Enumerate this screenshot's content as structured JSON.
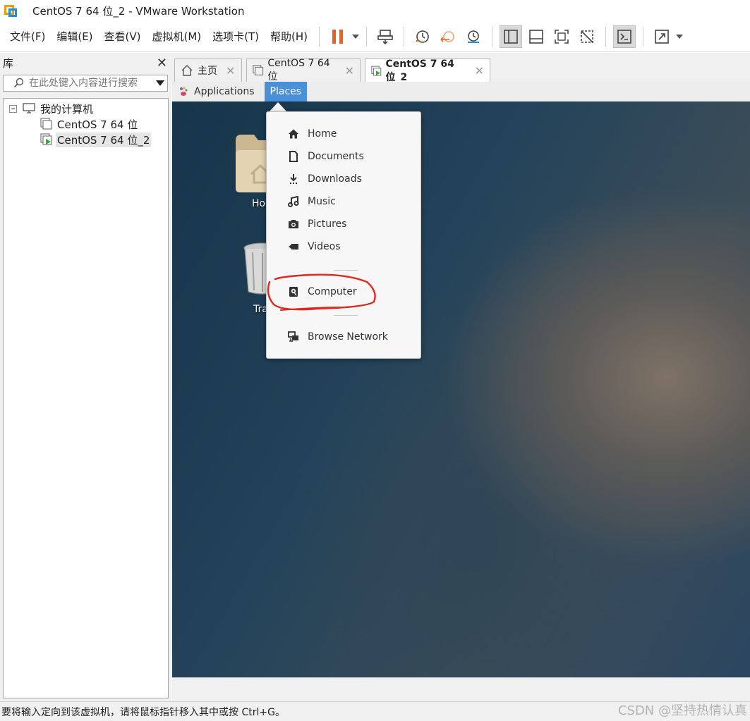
{
  "window": {
    "title": "CentOS 7 64 位_2 - VMware Workstation"
  },
  "menu": {
    "items": [
      "文件(F)",
      "编辑(E)",
      "查看(V)",
      "虚拟机(M)",
      "选项卡(T)",
      "帮助(H)"
    ]
  },
  "toolbar": {
    "icons": [
      "pause-icon",
      "send-ctrl-alt-del-icon",
      "snapshot-icon",
      "revert-snapshot-icon",
      "snapshot-manager-icon",
      "library-view-icon",
      "thumbnail-view-icon",
      "fullscreen-icon",
      "unity-icon",
      "console-icon",
      "stretch-icon"
    ],
    "accent_color": "#e8631e"
  },
  "library": {
    "title": "库",
    "search_placeholder": "在此处键入内容进行搜索",
    "tree": {
      "root": "我的计算机",
      "vms": [
        "CentOS 7 64 位",
        "CentOS 7 64 位_2"
      ]
    }
  },
  "tabs": [
    {
      "label": "主页"
    },
    {
      "label": "CentOS 7 64 位"
    },
    {
      "label": "CentOS 7 64 位_2"
    }
  ],
  "guest": {
    "topbar": {
      "applications": "Applications",
      "places": "Places"
    },
    "desktop_labels": {
      "home": "Ho",
      "trash": "Tra"
    },
    "places_menu": {
      "items": [
        "Home",
        "Documents",
        "Downloads",
        "Music",
        "Pictures",
        "Videos"
      ],
      "computer": "Computer",
      "network": "Browse Network"
    },
    "highlight_color": "#e0281e"
  },
  "statusbar": {
    "text": "要将输入定向到该虚拟机，请将鼠标指针移入其中或按 Ctrl+G。",
    "watermark": "CSDN @坚持热情认真"
  }
}
